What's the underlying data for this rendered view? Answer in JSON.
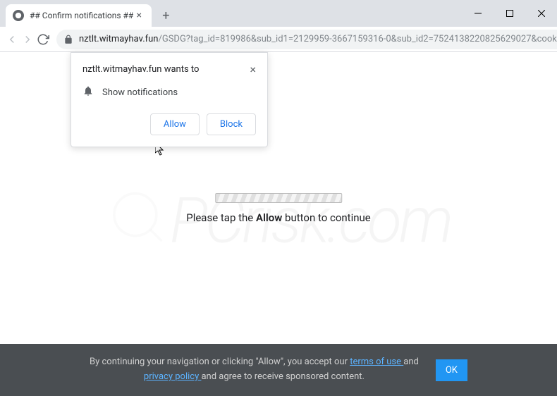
{
  "window": {
    "tab_title": "## Confirm notifications ##",
    "url_domain": "nztlt.witmayhav.fun",
    "url_path": "/GSDG?tag_id=819986&sub_id1=2129959-3667159316-0&sub_id2=7524138220825629027&cookie_..."
  },
  "prompt": {
    "site_wants": "nztlt.witmayhav.fun wants to",
    "permission_label": "Show notifications",
    "allow": "Allow",
    "block": "Block"
  },
  "page": {
    "instruction_prefix": "Please tap the ",
    "instruction_bold": "Allow",
    "instruction_suffix": " button to continue"
  },
  "cookie": {
    "text_1": "By continuing your navigation or clicking \"Allow\", you accept our ",
    "terms_link": "terms of use ",
    "text_2": "and ",
    "privacy_link": "privacy policy ",
    "text_3": "and agree to receive sponsored content.",
    "ok": "OK"
  },
  "watermark": "PCrisk.com"
}
